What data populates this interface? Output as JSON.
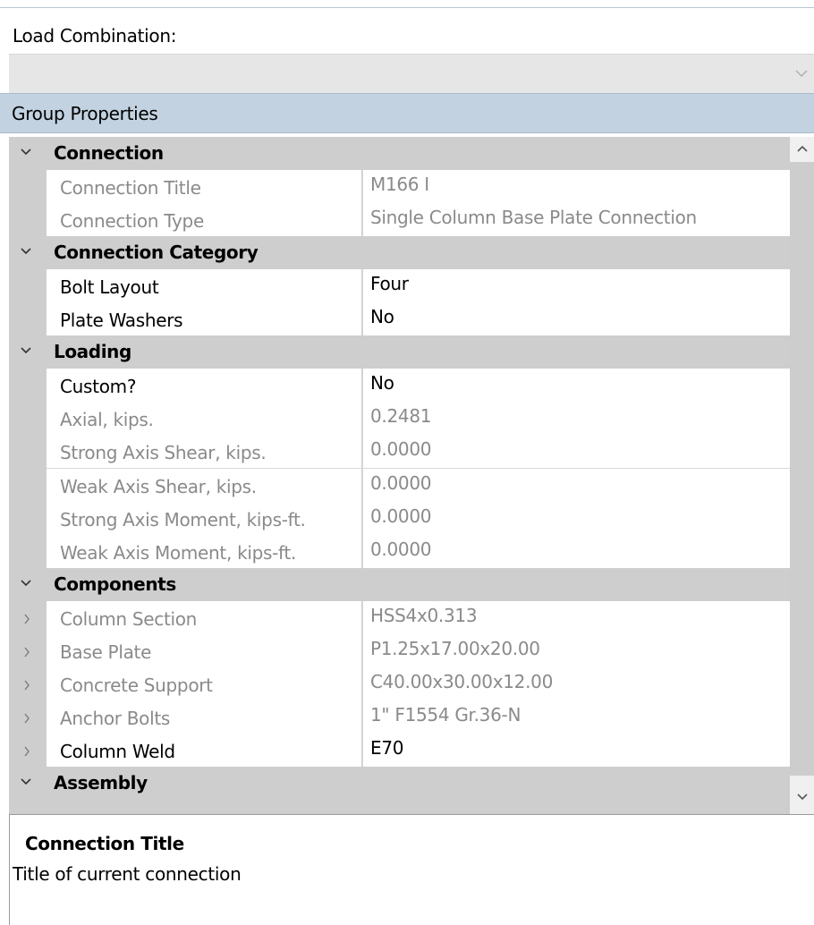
{
  "load_combination": {
    "label": "Load Combination:",
    "selected": ""
  },
  "group_properties": {
    "label": "Group Properties"
  },
  "grid": {
    "rows": [
      {
        "type": "category",
        "label": "Connection"
      },
      {
        "type": "property",
        "label": "Connection Title",
        "value": "M166 I",
        "readonly": true
      },
      {
        "type": "property",
        "label": "Connection Type",
        "value": "Single Column Base Plate Connection",
        "readonly": true
      },
      {
        "type": "category",
        "label": "Connection Category"
      },
      {
        "type": "property",
        "label": "Bolt Layout",
        "value": "Four",
        "readonly": false
      },
      {
        "type": "property",
        "label": "Plate Washers",
        "value": "No",
        "readonly": false
      },
      {
        "type": "category",
        "label": "Loading"
      },
      {
        "type": "property",
        "label": "Custom?",
        "value": "No",
        "readonly": false
      },
      {
        "type": "property",
        "label": "Axial, kips.",
        "value": "0.2481",
        "readonly": true
      },
      {
        "type": "property",
        "label": "Strong Axis Shear, kips.",
        "value": "0.0000",
        "readonly": true
      },
      {
        "type": "property",
        "label": "Weak Axis Shear, kips.",
        "value": "0.0000",
        "readonly": true
      },
      {
        "type": "property",
        "label": "Strong Axis Moment, kips-ft.",
        "value": "0.0000",
        "readonly": true
      },
      {
        "type": "property",
        "label": "Weak Axis Moment, kips-ft.",
        "value": "0.0000",
        "readonly": true
      },
      {
        "type": "category",
        "label": "Components"
      },
      {
        "type": "property",
        "label": "Column Section",
        "value": "HSS4x0.313",
        "readonly": true,
        "expandable": true
      },
      {
        "type": "property",
        "label": "Base Plate",
        "value": "P1.25x17.00x20.00",
        "readonly": true,
        "expandable": true
      },
      {
        "type": "property",
        "label": "Concrete Support",
        "value": "C40.00x30.00x12.00",
        "readonly": true,
        "expandable": true
      },
      {
        "type": "property",
        "label": "Anchor Bolts",
        "value": "1\" F1554 Gr.36-N",
        "readonly": true,
        "expandable": true
      },
      {
        "type": "property",
        "label": "Column Weld",
        "value": "E70",
        "readonly": false,
        "expandable": true
      },
      {
        "type": "category",
        "label": "Assembly"
      }
    ]
  },
  "help": {
    "title": "Connection Title",
    "description": "Title of current connection"
  },
  "colors": {
    "header_bg": "#c2d2e1",
    "category_bg": "#cecece",
    "readonly_text": "#8a8a8a",
    "select_bg": "#e6e6e6"
  },
  "icons": {
    "category_expander": "chevron-down-icon",
    "sub_expander": "chevron-right-icon",
    "scroll_up": "scroll-up-icon",
    "scroll_down": "scroll-down-icon",
    "dropdown": "chevron-down-icon"
  }
}
